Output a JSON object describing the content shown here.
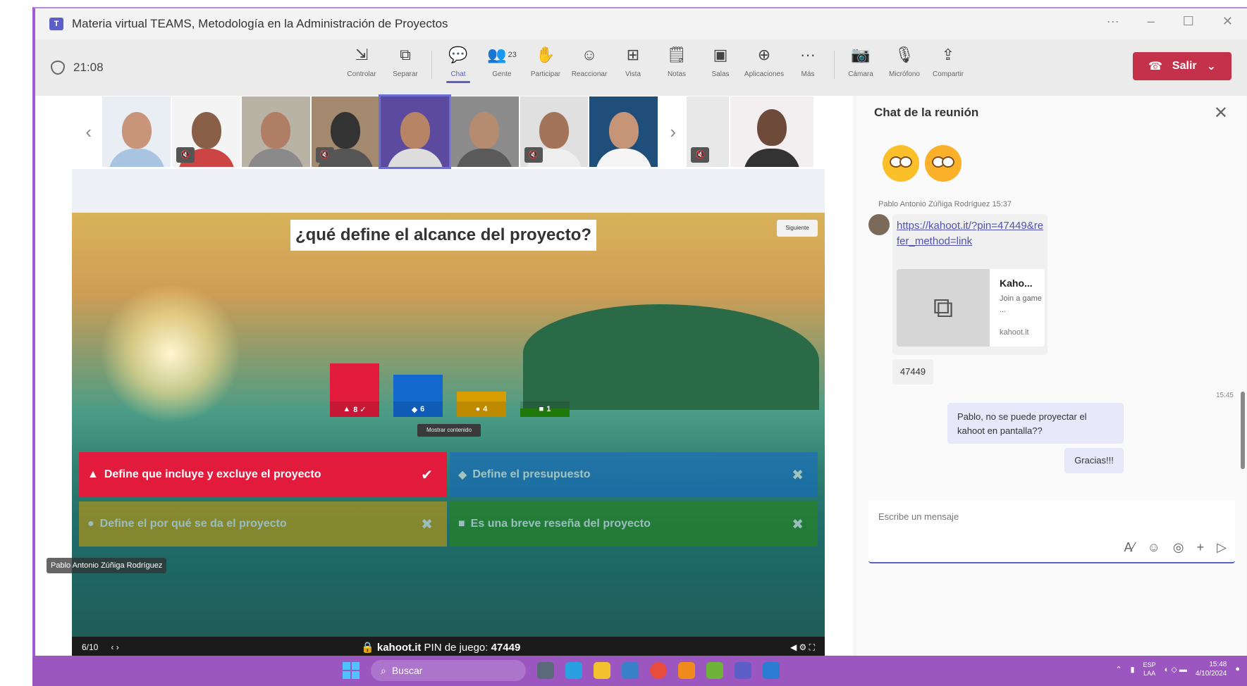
{
  "window": {
    "title": "Materia virtual TEAMS, Metodología en la Administración de Proyectos"
  },
  "toolbar": {
    "clock": "21:08",
    "tools": [
      {
        "id": "controlar",
        "label": "Controlar",
        "icon": "control-icon"
      },
      {
        "id": "separar",
        "label": "Separar",
        "icon": "popout-icon"
      },
      {
        "id": "chat",
        "label": "Chat",
        "icon": "chat-icon",
        "active": true
      },
      {
        "id": "gente",
        "label": "Gente",
        "icon": "people-icon",
        "count": "23"
      },
      {
        "id": "participar",
        "label": "Participar",
        "icon": "raise-hand-icon"
      },
      {
        "id": "reaccionar",
        "label": "Reaccionar",
        "icon": "smiley-icon"
      },
      {
        "id": "vista",
        "label": "Vista",
        "icon": "grid-icon"
      },
      {
        "id": "notas",
        "label": "Notas",
        "icon": "notes-icon"
      },
      {
        "id": "salas",
        "label": "Salas",
        "icon": "rooms-icon"
      },
      {
        "id": "aplicaciones",
        "label": "Aplicaciones",
        "icon": "apps-icon"
      },
      {
        "id": "mas",
        "label": "Más",
        "icon": "more-icon"
      },
      {
        "id": "camara",
        "label": "Cámara",
        "icon": "camera-off-icon"
      },
      {
        "id": "microfono",
        "label": "Micrófono",
        "icon": "mic-off-icon"
      },
      {
        "id": "compartir",
        "label": "Compartir",
        "icon": "share-icon"
      }
    ],
    "leave_label": "Salir"
  },
  "kahoot": {
    "question": "¿qué define el alcance del proyecto?",
    "next_label": "Siguiente",
    "show_content": "Mostrar contenido",
    "bars": [
      {
        "color": "#e21b3c",
        "count": "8 ✓",
        "level": 0.95
      },
      {
        "color": "#1368ce",
        "count": "6",
        "level": 0.75
      },
      {
        "color": "#d89e00",
        "count": "4",
        "level": 0.45
      },
      {
        "color": "#26890c",
        "count": "1",
        "level": 0.15
      }
    ],
    "answers": [
      {
        "shape": "▲",
        "text": "Define que incluye y excluye el proyecto",
        "color": "#e21b3c",
        "mark": "✔",
        "correct": true
      },
      {
        "shape": "◆",
        "text": "Define el presupuesto",
        "color": "#1368ce",
        "mark": "✖",
        "correct": false
      },
      {
        "shape": "●",
        "text": "Define el por qué se da el proyecto",
        "color": "#d89e00",
        "mark": "✖",
        "correct": false
      },
      {
        "shape": "■",
        "text": "Es una breve reseña del proyecto",
        "color": "#26890c",
        "mark": "✖",
        "correct": false
      }
    ],
    "footer": {
      "progress": "6/10",
      "site": "kahoot.it",
      "pin_label": "PIN de juego:",
      "pin": "47449"
    }
  },
  "presenter_name": "Pablo Antonio Zúñiga Rodríguez",
  "chat": {
    "title": "Chat de la reunión",
    "sender": "Pablo Antonio Zúñiga Rodríguez",
    "sender_time": "15:37",
    "link": "https://kahoot.it/?pin=47449&refer_method=link",
    "card": {
      "title": "Kaho...",
      "desc": "Join a game ...",
      "domain": "kahoot.it"
    },
    "pin_message": "47449",
    "my_time": "15:45",
    "my_message": "Pablo, no se puede proyectar el kahoot en pantalla??",
    "my_message2": "Gracias!!!",
    "compose_placeholder": "Escribe un mensaje"
  },
  "taskbar": {
    "search": "Buscar",
    "lang1": "ESP",
    "lang2": "LAA",
    "time": "15:48",
    "date": "4/10/2024"
  },
  "colors": {
    "accent": "#5b5fc7",
    "leave": "#c4314b",
    "taskbar": "#9b56c0"
  }
}
